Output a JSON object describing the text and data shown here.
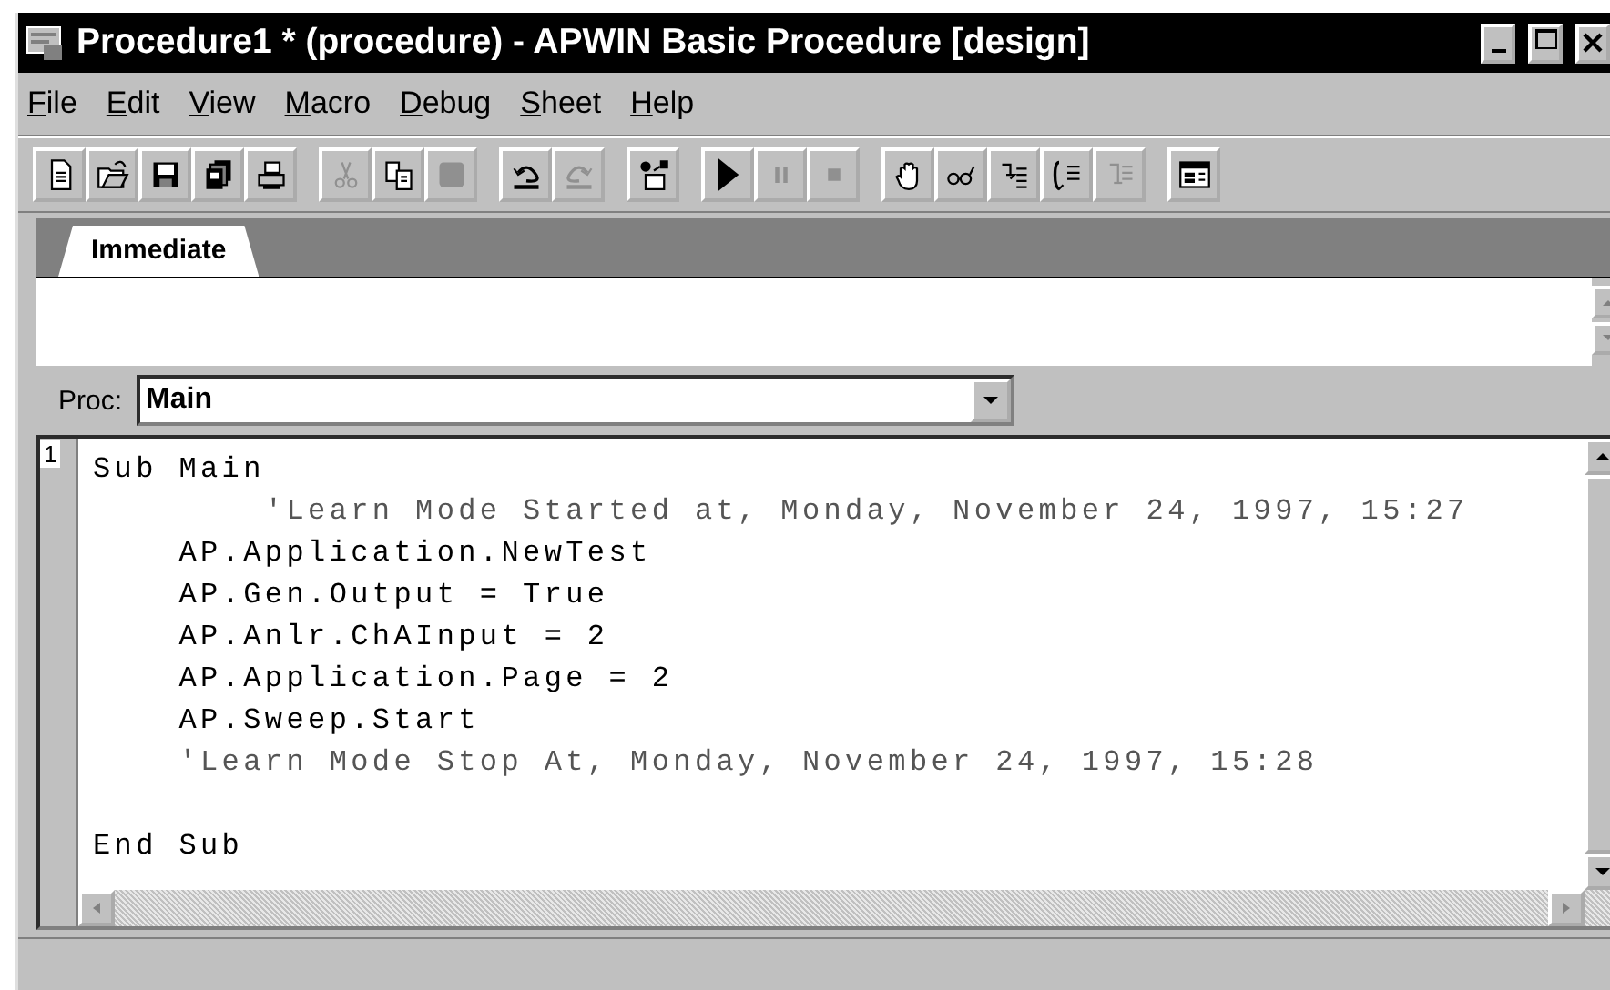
{
  "window": {
    "title": "Procedure1 * (procedure) - APWIN Basic Procedure [design]"
  },
  "menu": [
    "File",
    "Edit",
    "View",
    "Macro",
    "Debug",
    "Sheet",
    "Help"
  ],
  "toolbar": [
    [
      {
        "kind": "new",
        "disabled": false
      },
      {
        "kind": "open",
        "disabled": false
      },
      {
        "kind": "save",
        "disabled": false
      },
      {
        "kind": "copies",
        "disabled": false
      },
      {
        "kind": "print",
        "disabled": false
      }
    ],
    [
      {
        "kind": "cut",
        "disabled": true
      },
      {
        "kind": "copy",
        "disabled": false
      },
      {
        "kind": "paste",
        "disabled": true
      }
    ],
    [
      {
        "kind": "undo",
        "disabled": false
      },
      {
        "kind": "redo",
        "disabled": true
      }
    ],
    [
      {
        "kind": "objects",
        "disabled": false
      }
    ],
    [
      {
        "kind": "run",
        "disabled": false
      },
      {
        "kind": "pause",
        "disabled": true
      },
      {
        "kind": "stop",
        "disabled": true
      }
    ],
    [
      {
        "kind": "hand",
        "disabled": false
      },
      {
        "kind": "watch",
        "disabled": false
      },
      {
        "kind": "stepin",
        "disabled": false
      },
      {
        "kind": "stepover",
        "disabled": false
      },
      {
        "kind": "stepout",
        "disabled": true
      }
    ],
    [
      {
        "kind": "dialog",
        "disabled": false
      }
    ]
  ],
  "tabs": [
    {
      "label": "Immediate",
      "selected": true
    }
  ],
  "proc": {
    "label": "Proc:",
    "value": "Main"
  },
  "editor": {
    "line_number": "1",
    "lines": [
      {
        "kind": "code",
        "text": "Sub Main"
      },
      {
        "kind": "comment",
        "text": "        'Learn Mode Started at, Monday, November 24, 1997, 15:27"
      },
      {
        "kind": "code",
        "text": "    AP.Application.NewTest"
      },
      {
        "kind": "code",
        "text": "    AP.Gen.Output = True"
      },
      {
        "kind": "code",
        "text": "    AP.Anlr.ChAInput = 2"
      },
      {
        "kind": "code",
        "text": "    AP.Application.Page = 2"
      },
      {
        "kind": "code",
        "text": "    AP.Sweep.Start"
      },
      {
        "kind": "comment",
        "text": "    'Learn Mode Stop At, Monday, November 24, 1997, 15:28"
      },
      {
        "kind": "blank"
      },
      {
        "kind": "code",
        "text": "End Sub"
      }
    ]
  }
}
